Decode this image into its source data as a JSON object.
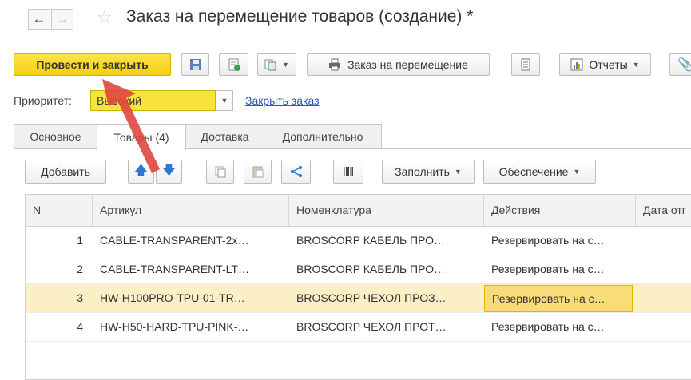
{
  "window": {
    "title": "Заказ на перемещение товаров (создание) *"
  },
  "toolbar": {
    "post_and_close": "Провести и закрыть",
    "move_order": "Заказ на перемещение",
    "reports": "Отчеты"
  },
  "priority": {
    "label": "Приоритет:",
    "value": "Высокий",
    "close_order_link": "Закрыть заказ"
  },
  "tabs": [
    {
      "label": "Основное",
      "active": false
    },
    {
      "label": "Товары (4)",
      "active": true
    },
    {
      "label": "Доставка",
      "active": false
    },
    {
      "label": "Дополнительно",
      "active": false
    }
  ],
  "table_toolbar": {
    "add": "Добавить",
    "fill": "Заполнить",
    "supply": "Обеспечение"
  },
  "table": {
    "columns": [
      "N",
      "Артикул",
      "Номенклатура",
      "Действия",
      "Дата отг"
    ],
    "rows": [
      {
        "n": "1",
        "article": "CABLE-TRANSPARENT-2x…",
        "nomenclature": "BROSCORP КАБЕЛЬ ПРО…",
        "action": "Резервировать на с…",
        "date": ""
      },
      {
        "n": "2",
        "article": "CABLE-TRANSPARENT-LT…",
        "nomenclature": "BROSCORP КАБЕЛЬ ПРО…",
        "action": "Резервировать на с…",
        "date": ""
      },
      {
        "n": "3",
        "article": "HW-H100PRO-TPU-01-TR…",
        "nomenclature": "BROSCORP ЧЕХОЛ ПРОЗ…",
        "action": "Резервировать на с…",
        "date": ""
      },
      {
        "n": "4",
        "article": "HW-H50-HARD-TPU-PINK-…",
        "nomenclature": "BROSCORP ЧЕХОЛ ПРОТ…",
        "action": "Резервировать на с…",
        "date": ""
      }
    ],
    "selected_row": 3
  },
  "colors": {
    "primary_button": "#f5cf12",
    "priority_field": "#f9e23c",
    "selected_row": "#fbefc5",
    "link": "#2a57b8",
    "annotation_arrow": "#e0463e"
  }
}
